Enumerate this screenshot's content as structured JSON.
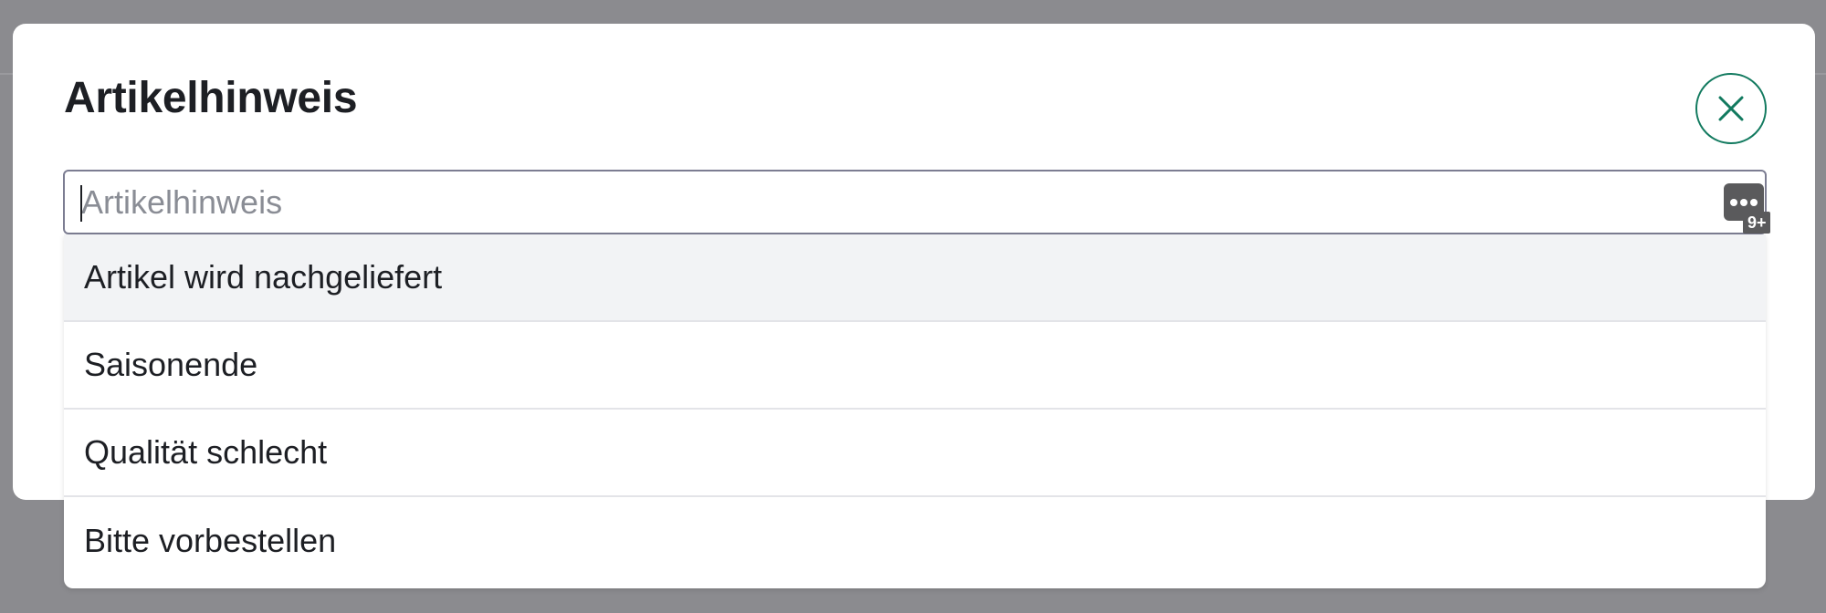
{
  "dialog": {
    "title": "Artikelhinweis",
    "close_icon": "close-icon",
    "accent_color": "#127a5f"
  },
  "input": {
    "placeholder": "Artikelhinweis",
    "value": "",
    "icon": "password-manager-icon",
    "badge": "9+"
  },
  "dropdown": {
    "options": [
      "Artikel wird nachgeliefert",
      "Saisonende",
      "Qualität schlecht",
      "Bitte vorbestellen"
    ],
    "highlighted_index": 0
  }
}
